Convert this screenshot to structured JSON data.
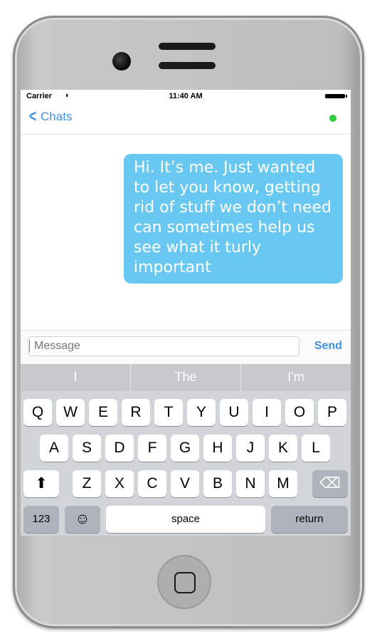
{
  "status_bar": {
    "carrier": "Carrier",
    "wifi_icon": "◗",
    "time": "11:40 AM"
  },
  "nav": {
    "back_chevron": "<",
    "back_label": "Chats",
    "online_color": "#2ecc40"
  },
  "conversation": {
    "messages": [
      {
        "from": "me",
        "text": "Hi. It’s me. Just wanted to let you know, getting rid of stuff we don’t need can sometimes help us see what it turly important"
      }
    ]
  },
  "composer": {
    "placeholder": "Message",
    "send_label": "Send"
  },
  "suggestions": [
    "I",
    "The",
    "I'm"
  ],
  "keyboard": {
    "row1": [
      "Q",
      "W",
      "E",
      "R",
      "T",
      "Y",
      "U",
      "I",
      "O",
      "P"
    ],
    "row2": [
      "A",
      "S",
      "D",
      "F",
      "G",
      "H",
      "J",
      "K",
      "L"
    ],
    "row3": [
      "Z",
      "X",
      "C",
      "V",
      "B",
      "N",
      "M"
    ],
    "shift_icon": "⬆",
    "backspace_icon": "⌫",
    "numbers_label": "123",
    "emoji_icon": "☺",
    "space_label": "space",
    "return_label": "return"
  },
  "colors": {
    "accent": "#3f91e4",
    "bubble": "#69c8f2",
    "keyboard_bg": "#d1d4d9"
  }
}
